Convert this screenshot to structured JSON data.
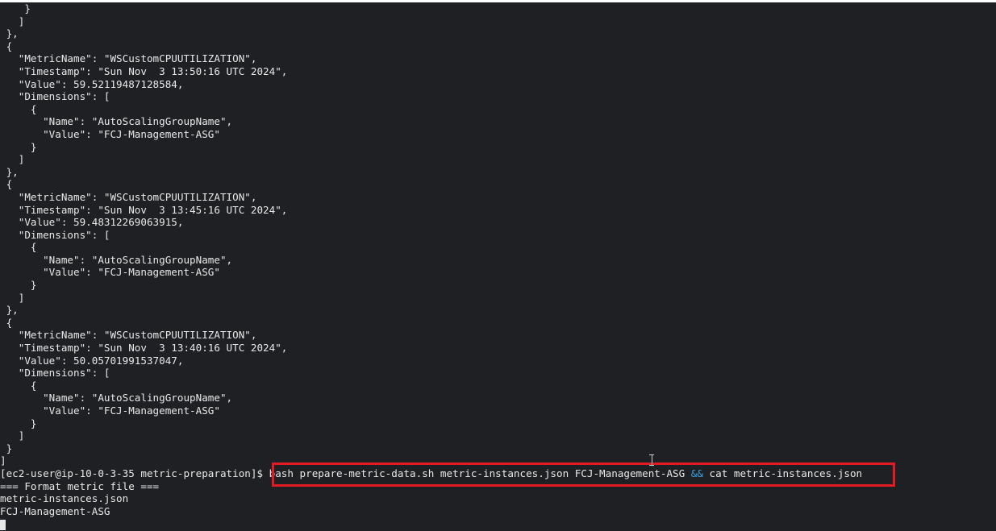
{
  "terminal": {
    "output_lines": [
      "    }",
      "   ]",
      " },",
      " {",
      "   \"MetricName\": \"WSCustomCPUUTILIZATION\",",
      "   \"Timestamp\": \"Sun Nov  3 13:50:16 UTC 2024\",",
      "   \"Value\": 59.52119487128584,",
      "   \"Dimensions\": [",
      "     {",
      "       \"Name\": \"AutoScalingGroupName\",",
      "       \"Value\": \"FCJ-Management-ASG\"",
      "     }",
      "   ]",
      " },",
      " {",
      "   \"MetricName\": \"WSCustomCPUUTILIZATION\",",
      "   \"Timestamp\": \"Sun Nov  3 13:45:16 UTC 2024\",",
      "   \"Value\": 59.48312269063915,",
      "   \"Dimensions\": [",
      "     {",
      "       \"Name\": \"AutoScalingGroupName\",",
      "       \"Value\": \"FCJ-Management-ASG\"",
      "     }",
      "   ]",
      " },",
      " {",
      "   \"MetricName\": \"WSCustomCPUUTILIZATION\",",
      "   \"Timestamp\": \"Sun Nov  3 13:40:16 UTC 2024\",",
      "   \"Value\": 50.05701991537047,",
      "   \"Dimensions\": [",
      "     {",
      "       \"Name\": \"AutoScalingGroupName\",",
      "       \"Value\": \"FCJ-Management-ASG\"",
      "     }",
      "   ]",
      " }",
      "]"
    ],
    "prompt": "[ec2-user@ip-10-0-3-35 metric-preparation]$ ",
    "command_part1": "bash prepare-metric-data.sh metric-instances.json FCJ-Management-ASG ",
    "command_operator": "&&",
    "command_part2": " cat metric-instances.json",
    "after_lines": [
      "=== Format metric file ===",
      "metric-instances.json",
      "FCJ-Management-ASG"
    ],
    "colors": {
      "background": "#1f2023",
      "text": "#e8e8e8",
      "operator": "#3aa0e6",
      "highlight_border": "#e01b24"
    }
  }
}
